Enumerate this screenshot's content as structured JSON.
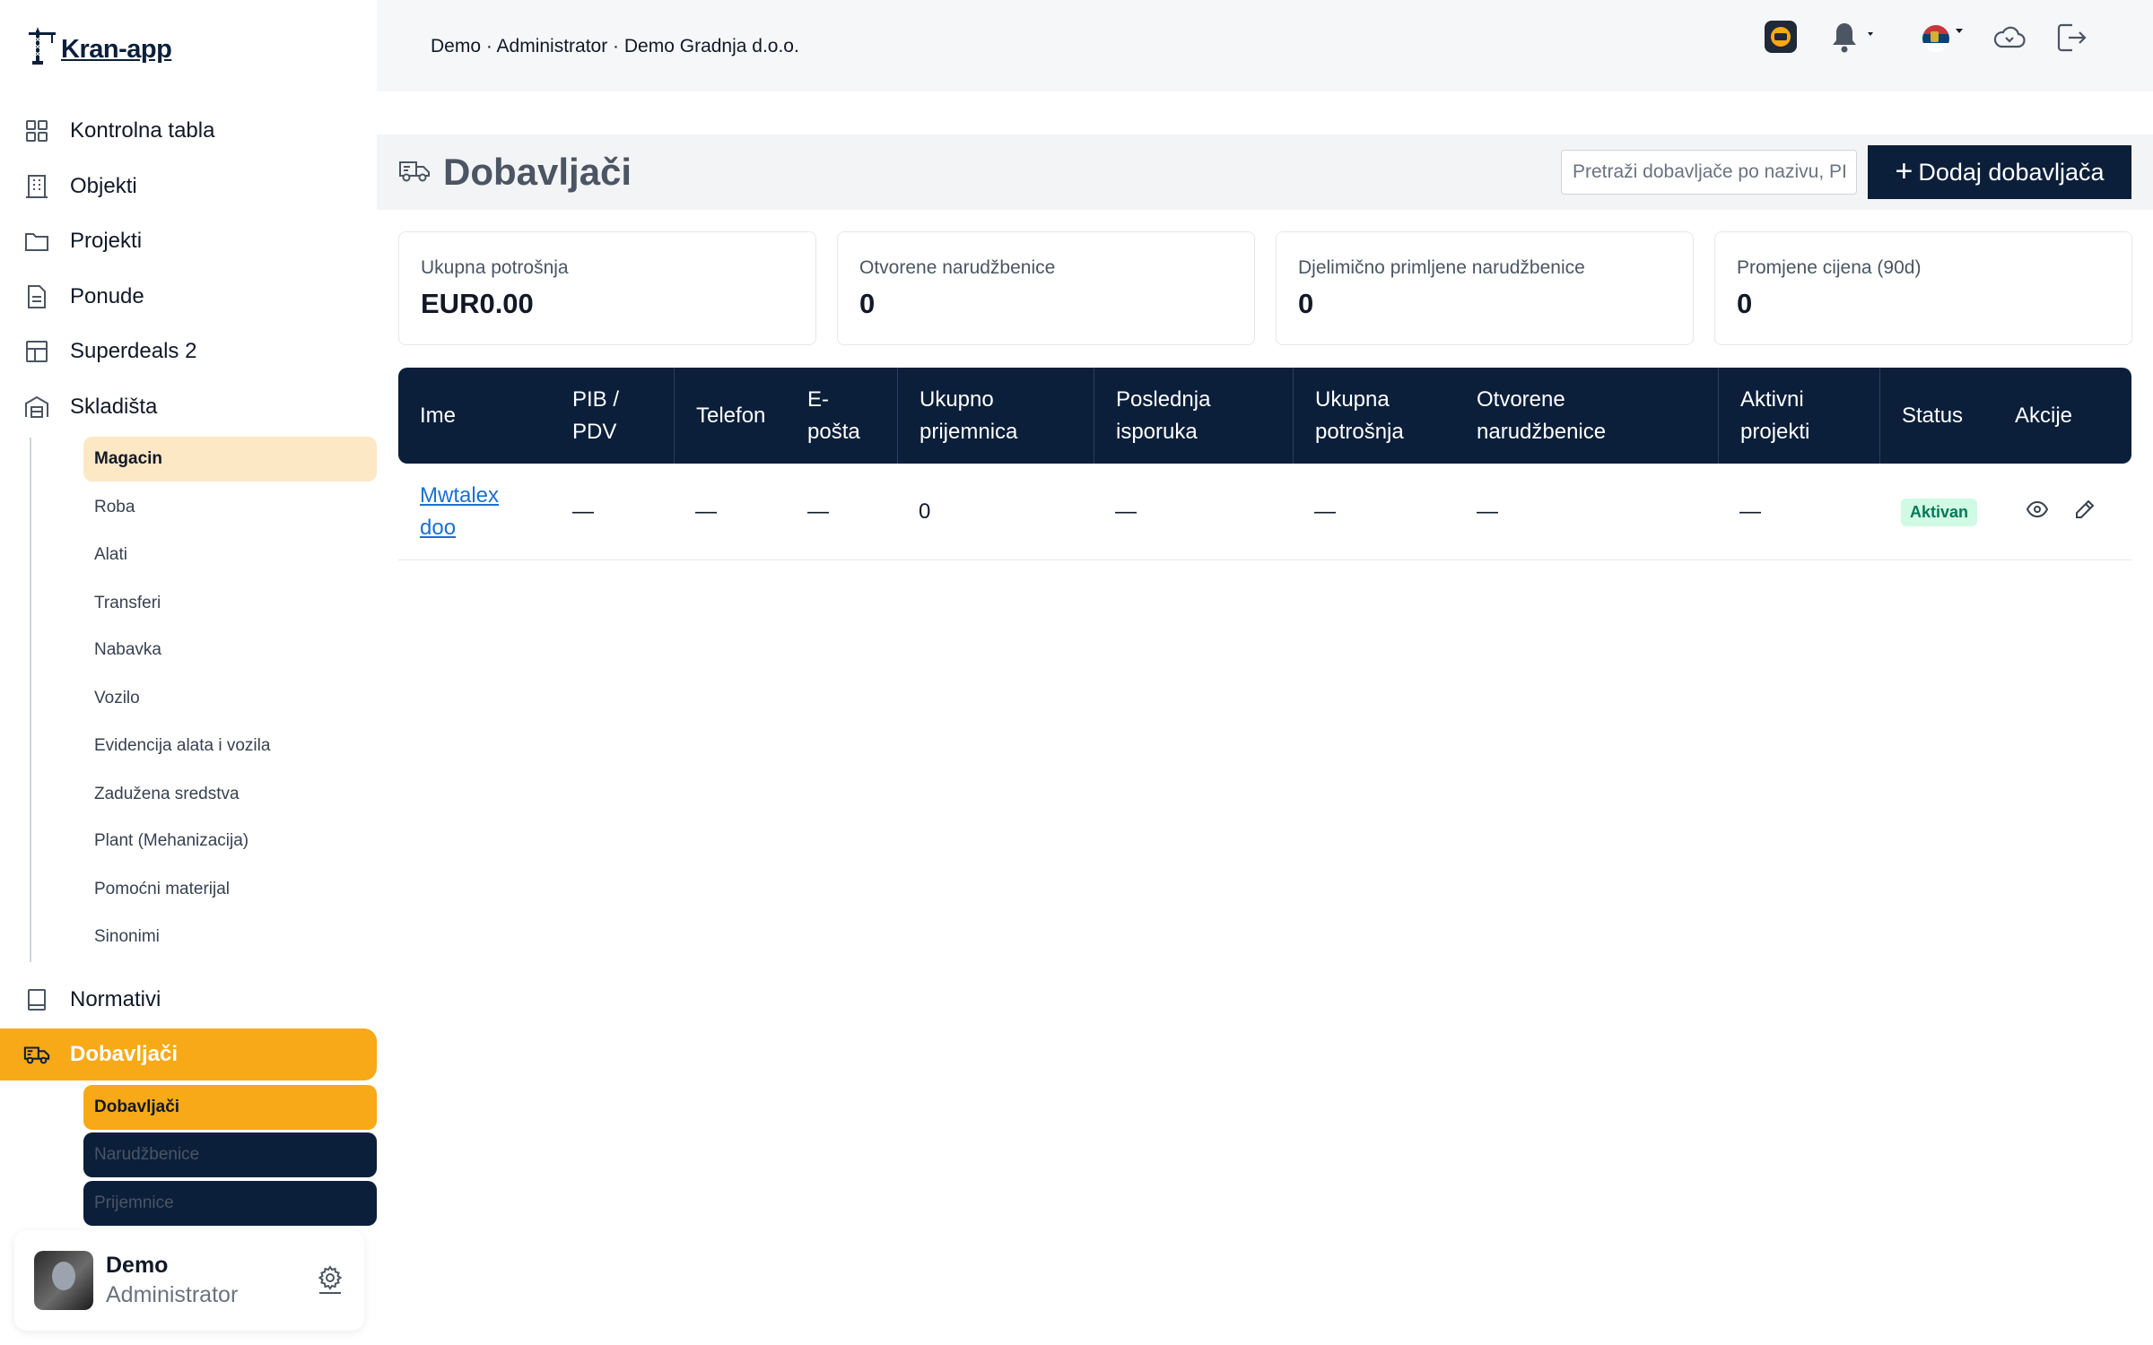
{
  "app": {
    "name": "Kran-app"
  },
  "breadcrumb": "Demo · Administrator · Demo Gradnja d.o.o.",
  "sidebar": {
    "items": [
      {
        "label": "Kontrolna tabla",
        "icon": "grid-icon"
      },
      {
        "label": "Objekti",
        "icon": "building-icon"
      },
      {
        "label": "Projekti",
        "icon": "folder-icon"
      },
      {
        "label": "Ponude",
        "icon": "document-icon"
      },
      {
        "label": "Superdeals 2",
        "icon": "table-icon"
      },
      {
        "label": "Skladišta",
        "icon": "warehouse-icon"
      },
      {
        "label": "Normativi",
        "icon": "book-icon"
      },
      {
        "label": "Dobavljači",
        "icon": "truck-icon"
      }
    ],
    "skladista_sub": [
      "Magacin",
      "Roba",
      "Alati",
      "Transferi",
      "Nabavka",
      "Vozilo",
      "Evidencija alata i vozila",
      "Zadužena sredstva",
      "Plant (Mehanizacija)",
      "Pomoćni materijal",
      "Sinonimi"
    ],
    "dobavljaci_sub": [
      "Dobavljači",
      "Narudžbenice",
      "Prijemnice"
    ]
  },
  "user": {
    "name": "Demo",
    "role": "Administrator"
  },
  "page": {
    "title": "Dobavljači",
    "search_placeholder": "Pretraži dobavljače po nazivu, PIB",
    "add_label": "Dodaj dobavljača",
    "add_plus": "+"
  },
  "stats": [
    {
      "label": "Ukupna potrošnja",
      "value": "EUR0.00"
    },
    {
      "label": "Otvorene narudžbenice",
      "value": "0"
    },
    {
      "label": "Djelimično primljene narudžbenice",
      "value": "0"
    },
    {
      "label": "Promjene cijena (90d)",
      "value": "0"
    }
  ],
  "table": {
    "columns": [
      "Ime",
      "PIB / PDV",
      "Telefon",
      "E-pošta",
      "Ukupno prijemnica",
      "Poslednja isporuka",
      "Ukupna potrošnja",
      "Otvorene narudžbenice",
      "Aktivni projekti",
      "Status",
      "Akcije"
    ],
    "rows": [
      {
        "ime": "Mwtalex doo",
        "pib": "—",
        "telefon": "—",
        "email": "—",
        "prijemnice": "0",
        "isporuka": "—",
        "potrosnja": "—",
        "narudzbenice": "—",
        "projekti": "—",
        "status": "Aktivan"
      }
    ]
  },
  "colors": {
    "navy": "#0b1f3a",
    "accent": "#f8a917",
    "accent_light": "#fde8c5",
    "link": "#1d6fd1",
    "status_bg": "#d1fae5",
    "status_text": "#047857"
  }
}
